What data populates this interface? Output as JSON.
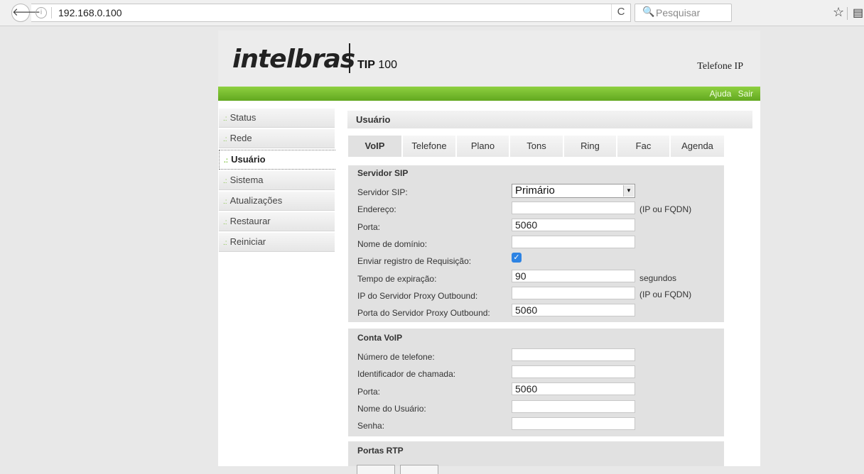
{
  "browser": {
    "url": "192.168.0.100",
    "search_placeholder": "Pesquisar",
    "back_glyph": "🡐",
    "reload_glyph": "C",
    "search_glyph": "🔍",
    "star_glyph": "☆",
    "reader_glyph": "▤"
  },
  "header": {
    "logo": "intelbras",
    "model_bold": "TIP",
    "model_num": "100",
    "right_label": "Telefone IP",
    "links": [
      "Ajuda",
      "Sair"
    ]
  },
  "sidebar": {
    "items": [
      {
        "label": "Status",
        "active": false
      },
      {
        "label": "Rede",
        "active": false
      },
      {
        "label": "Usuário",
        "active": true
      },
      {
        "label": "Sistema",
        "active": false
      },
      {
        "label": "Atualizações",
        "active": false
      },
      {
        "label": "Restaurar",
        "active": false
      },
      {
        "label": "Reiniciar",
        "active": false
      }
    ],
    "dots": ".:"
  },
  "main": {
    "section_title": "Usuário",
    "tabs": [
      "VoIP",
      "Telefone",
      "Plano",
      "Tons",
      "Ring",
      "Fac",
      "Agenda"
    ],
    "active_tab": "VoIP"
  },
  "sip": {
    "title": "Servidor SIP",
    "server_label": "Servidor SIP:",
    "server_value": "Primário",
    "address_label": "Endereço:",
    "address_value": "",
    "address_hint": "(IP ou FQDN)",
    "port_label": "Porta:",
    "port_value": "5060",
    "domain_label": "Nome de domínio:",
    "domain_value": "",
    "register_label": "Enviar registro de Requisição:",
    "register_checked": true,
    "expire_label": "Tempo de expiração:",
    "expire_value": "90",
    "expire_hint": "segundos",
    "proxy_ip_label": "IP do Servidor Proxy Outbound:",
    "proxy_ip_value": "",
    "proxy_ip_hint": "(IP ou FQDN)",
    "proxy_port_label": "Porta do Servidor Proxy Outbound:",
    "proxy_port_value": "5060"
  },
  "account": {
    "title": "Conta VoIP",
    "phone_label": "Número de telefone:",
    "phone_value": "",
    "caller_label": "Identificador de chamada:",
    "caller_value": "",
    "port_label": "Porta:",
    "port_value": "5060",
    "user_label": "Nome do Usuário:",
    "user_value": "",
    "password_label": "Senha:",
    "password_value": ""
  },
  "rtp": {
    "title": "Portas RTP"
  }
}
